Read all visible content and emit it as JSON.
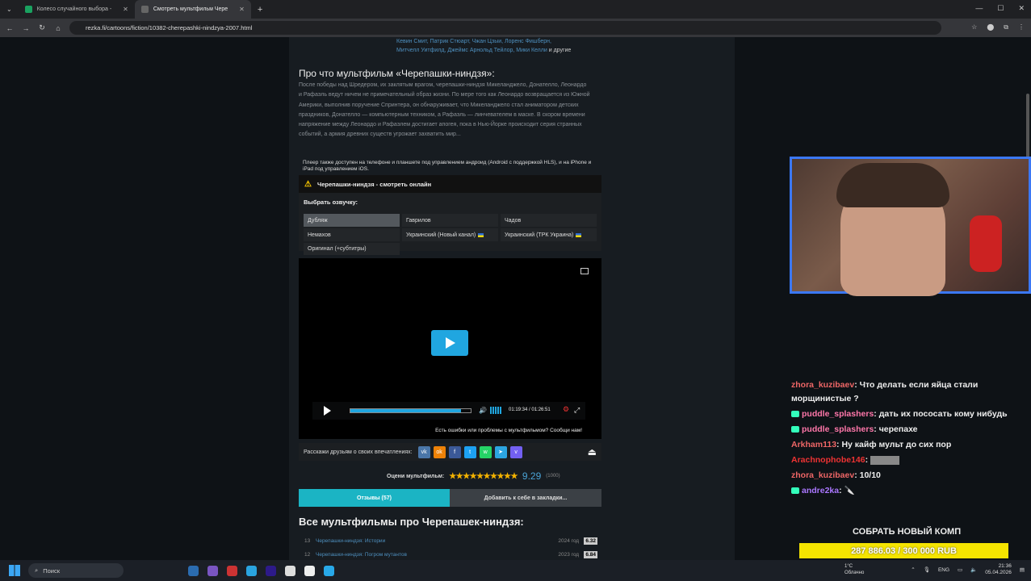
{
  "browser": {
    "tabs": [
      {
        "label": "Колесо случайного выбора -",
        "color": "#1aa260"
      },
      {
        "label": "Смотреть мультфильм Чере",
        "color": "#555"
      }
    ],
    "url": "rezka.fi/cartoons/fiction/10382-cherepashki-nindzya-2007.html"
  },
  "cast": {
    "line1": "Кевин Смит, Патрик Стюарт, Чжан Цзыи, Лоренс Фишберн,",
    "line2a": "Митчелл Уитфилд, Джеймс Арнольд Тейлор, Мики Келли",
    "line2b": " и другие"
  },
  "about": {
    "title": "Про что мультфильм «Черепашки-ниндзя»:",
    "text": "После победы над Шредером, их заклятым врагом, черепашки-ниндзя Микеланджело, Донателло, Леонардо и Рафаэль ведут ничем не примечательный образ жизни. По мере того как Леонардо возвращается из Южной Америки, выполнив поручение Спринтера, он обнаруживает, что Микеланджело стал аниматором детских праздников, Донателло — компьютерным техником, а Рафаэль — линчевателем в маске. В скором времени напряжение между Леонардо и Рафаэлем достигает апогея, пока в Нью-Йорке происходит серия странных событий, а армия древних существ угрожает захватить мир..."
  },
  "note": "Плеер также доступен на телефоне и планшете под управлением андроид (Android с поддержкой HLS), и на iPhone и iPad под управлением iOS.",
  "watch": {
    "title": "Черепашки-ниндзя - смотреть онлайн",
    "select": "Выбрать озвучку:",
    "voices": [
      "Дубляж",
      "Гаврилов",
      "Чадов",
      "Немахов",
      "Украинский (Новый канал)",
      "Украинский (ТРК Украина)",
      "Оригинал (+субтитры)"
    ]
  },
  "player": {
    "time": "01:19:34 / 01:26:51",
    "progress": 0.92,
    "issue": "Есть ошибки или проблемы с мультфильмом? Сообщи нам!"
  },
  "share": {
    "label": "Расскажи друзьям о своих впечатлениях:",
    "icons": [
      {
        "t": "vk",
        "c": "#4a76a8"
      },
      {
        "t": "ok",
        "c": "#ee8208"
      },
      {
        "t": "f",
        "c": "#3b5998"
      },
      {
        "t": "t",
        "c": "#1da1f2"
      },
      {
        "t": "w",
        "c": "#25d366"
      },
      {
        "t": "tg",
        "c": "#2ca5e0"
      },
      {
        "t": "v",
        "c": "#7360f2"
      }
    ]
  },
  "rating": {
    "label": "Оцени мультфильм:",
    "stars": "★★★★★★★★★★",
    "score": "9.29",
    "count": "(1000)"
  },
  "buttons": {
    "reviews": "Отзывы (57)",
    "bookmark": "Добавить к себе в закладки..."
  },
  "franchise": {
    "title": "Все мультфильмы про Черепашек-ниндзя:",
    "items": [
      {
        "n": "13",
        "t": "Черепашки-ниндзя: Истории",
        "y": "2024 год",
        "r": "6.32"
      },
      {
        "n": "12",
        "t": "Черепашки-ниндзя: Погром мутантов",
        "y": "2023 год",
        "r": "6.84"
      }
    ]
  },
  "chat": [
    {
      "u": "zhora_kuzibaev",
      "c": "#e66",
      "b": false,
      "m": ": Что делать если яйца стали морщинистые ?"
    },
    {
      "u": "puddle_splashers",
      "c": "#f7a",
      "b": true,
      "m": ": дать их пососать кому нибудь"
    },
    {
      "u": "puddle_splashers",
      "c": "#f7a",
      "b": true,
      "m": ": черепахе"
    },
    {
      "u": "Arkham113",
      "c": "#e66",
      "b": false,
      "m": ": Ну кайф мульт до сих пор"
    },
    {
      "u": "Arachnophobe146",
      "c": "#e33",
      "b": false,
      "m": ":"
    },
    {
      "u": "zhora_kuzibaev",
      "c": "#e66",
      "b": false,
      "m": ": 10/10"
    },
    {
      "u": "andre2ka",
      "c": "#a7f",
      "b": true,
      "m": ":"
    }
  ],
  "goal": {
    "title": "СОБРАТЬ НОВЫЙ КОМП",
    "amount": "287 886.03 / 300 000 RUB"
  },
  "taskbar": {
    "search": "Поиск",
    "temp": "1°C",
    "weather": "Облачно",
    "lang": "ENG",
    "time": "21:36",
    "date": "05.04.2026"
  }
}
